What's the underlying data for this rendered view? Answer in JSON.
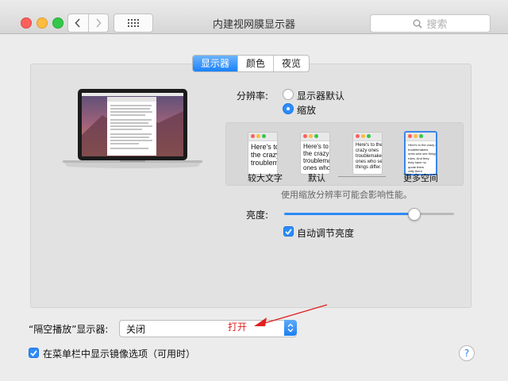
{
  "window": {
    "title": "内建视网膜显示器"
  },
  "toolbar": {
    "search_placeholder": "搜索"
  },
  "tabs": [
    {
      "label": "显示器",
      "active": true
    },
    {
      "label": "颜色",
      "active": false
    },
    {
      "label": "夜览",
      "active": false
    }
  ],
  "resolution": {
    "label": "分辨率:",
    "options": [
      {
        "label": "显示器默认",
        "selected": false
      },
      {
        "label": "缩放",
        "selected": true
      }
    ]
  },
  "scaling": {
    "thumbnails": [
      {
        "text": "Here's to\nthe crazy\ntroublema",
        "selected": false
      },
      {
        "text": "Here's to\nthe crazy\ntroublemakers\nones who see",
        "selected": false
      },
      {
        "text": "Here's to the\ncrazy ones\ntroublemakers\nones who see\nthings differ.",
        "selected": false
      },
      {
        "text": "Here's to the crazy ones\ntroublemakers\nones who see things\nrules. And they\nthey have no\nquote them\nvilify them",
        "selected": true
      }
    ],
    "captions": {
      "larger": "较大文字",
      "default": "默认",
      "more_space": "更多空间"
    },
    "note": "使用缩放分辨率可能会影响性能。"
  },
  "brightness": {
    "label": "亮度:",
    "value": 0.76,
    "auto_label": "自动调节亮度",
    "auto_checked": true
  },
  "airplay": {
    "label": "“隔空播放”显示器:",
    "value": "关闭"
  },
  "annotation": {
    "text": "打开",
    "color": "#e02020"
  },
  "mirroring": {
    "label": "在菜单栏中显示镜像选项（可用时）",
    "checked": true
  },
  "help": {
    "label": "?"
  },
  "colors": {
    "accent": "#2b8dfb",
    "annotation": "#e02020"
  },
  "icons": {
    "back": "chevron-left-icon",
    "forward": "chevron-right-icon",
    "grid": "grid-icon",
    "search": "search-icon",
    "help": "help-icon"
  }
}
